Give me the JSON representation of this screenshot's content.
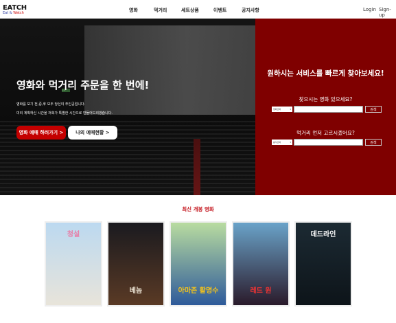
{
  "header": {
    "logo": {
      "title": "EATCH",
      "sub_a": "Eat &",
      "sub_b": "Watch"
    },
    "nav": [
      "영화",
      "먹거리",
      "세트상품",
      "이벤트",
      "공지사항"
    ],
    "login": "Login",
    "signup": "Sign-up"
  },
  "hero": {
    "title": "영화와 먹거리 주문을 한 번에!",
    "line1": "영화를 보기 전,중,후 모두 당신이 주인공입니다.",
    "line2": "미리 계획하신 시간을 저희가 특별한 시간으로 만들어드리겠습니다.",
    "exit_sign": "출구",
    "primary_btn": "영화 예매 하러가기  >",
    "secondary_btn": "나의 예매현황  >"
  },
  "search_panel": {
    "title": "원하시는 서비스를 빠르게 찾아보세요!",
    "movie": {
      "question": "찾으시는 영화 있으세요?",
      "select": "영화선택",
      "input": "",
      "button": "검색"
    },
    "food": {
      "question": "먹거리 먼저 고르시겠어요?",
      "select": "음식선택",
      "input": "",
      "button": "검색"
    }
  },
  "latest": {
    "title": "최신 개봉 영화",
    "movies": [
      {
        "title": "청설",
        "colors": [
          "#bcd9f0",
          "#e8e4da"
        ],
        "text_color": "#e77fa8"
      },
      {
        "title": "베놈",
        "colors": [
          "#1a1a1f",
          "#5a3a25"
        ],
        "text_color": "#e9e0d0"
      },
      {
        "title": "아마존 활명수",
        "colors": [
          "#b9dca0",
          "#2e5a9a"
        ],
        "text_color": "#f3c21b"
      },
      {
        "title": "레드 원",
        "colors": [
          "#6aa3c9",
          "#2a1a2a"
        ],
        "text_color": "#e33"
      },
      {
        "title": "데드라인",
        "colors": [
          "#1c2a33",
          "#0d1419"
        ],
        "text_color": "#fff"
      }
    ]
  }
}
